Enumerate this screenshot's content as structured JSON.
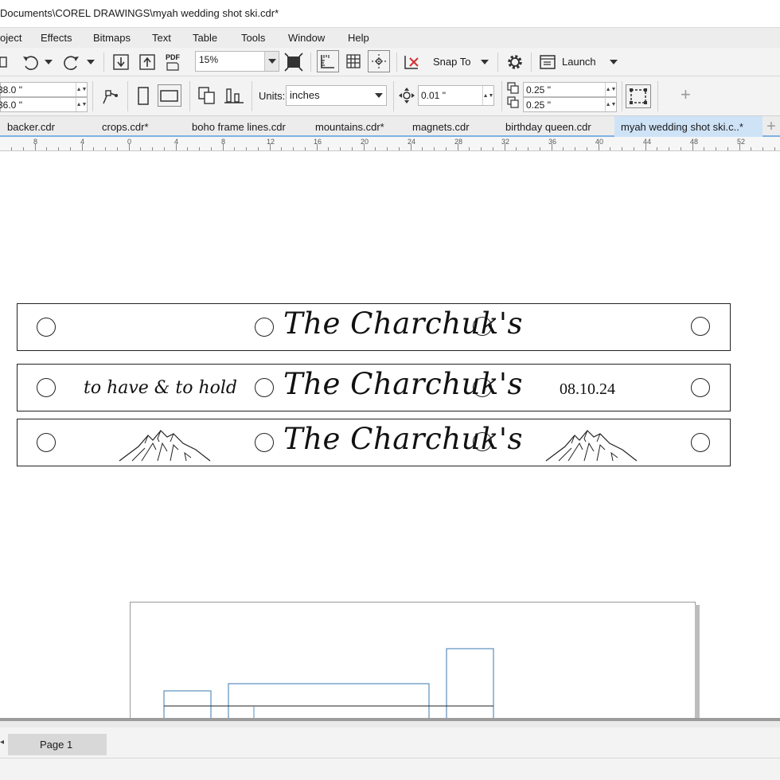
{
  "window": {
    "title": "Documents\\COREL DRAWINGS\\myah wedding shot ski.cdr*"
  },
  "menu": [
    "oject",
    "Effects",
    "Bitmaps",
    "Text",
    "Table",
    "Tools",
    "Window",
    "Help"
  ],
  "toolbar": {
    "pdf_label": "PDF",
    "zoom_value": "15%",
    "snap_label": "Snap To",
    "launch_label": "Launch"
  },
  "property_bar": {
    "width_value": "38.0 \"",
    "height_value": "36.0 \"",
    "units_label": "Units:",
    "units_value": "inches",
    "nudge_value": "0.01 \"",
    "dup_x_value": "0.25 \"",
    "dup_y_value": "0.25 \"",
    "add_preset": "+"
  },
  "tabs": [
    {
      "label": "backer.cdr",
      "active": false
    },
    {
      "label": "crops.cdr*",
      "active": false
    },
    {
      "label": "boho frame lines.cdr",
      "active": false
    },
    {
      "label": "mountains.cdr*",
      "active": false
    },
    {
      "label": "magnets.cdr",
      "active": false
    },
    {
      "label": "birthday queen.cdr",
      "active": false
    },
    {
      "label": "myah wedding shot ski.c..*",
      "active": true
    }
  ],
  "ruler_labels": [
    "8",
    "4",
    "0",
    "4",
    "8",
    "12",
    "16",
    "20",
    "24",
    "28",
    "32",
    "36",
    "40",
    "44",
    "48",
    "52"
  ],
  "design": {
    "name_text": "The Charchuk's",
    "motto_text": "to have & to hold",
    "date_text": "08.10.24"
  },
  "pages": {
    "current_label": "Page 1"
  },
  "colors": {
    "active_tab": "#cfe3f7",
    "tab_underline": "#7fb2e5",
    "outline_blue": "#5a8fbd"
  }
}
